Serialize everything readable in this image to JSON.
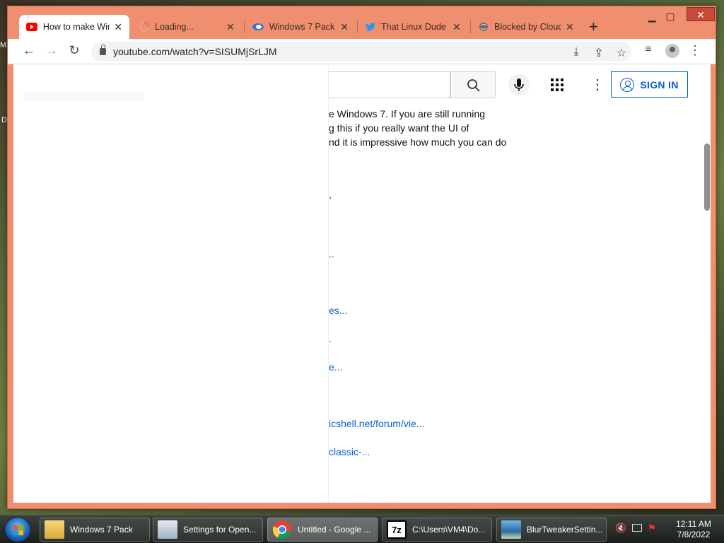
{
  "desktop": {
    "label_top": "M",
    "label_mid": "D"
  },
  "tabs": [
    {
      "title": "How to make Wir",
      "icon": "youtube-icon",
      "active": true
    },
    {
      "title": "Loading...",
      "icon": "loading-spinner-icon",
      "active": false
    },
    {
      "title": "Windows 7 Pack",
      "icon": "windows-pack-icon",
      "active": false
    },
    {
      "title": "That Linux Dude",
      "icon": "twitter-icon",
      "active": false
    },
    {
      "title": "Blocked by Cloud",
      "icon": "globe-icon",
      "active": false
    }
  ],
  "toolbar": {
    "url": "youtube.com/watch?v=SISUMjSrLJM"
  },
  "youtube": {
    "signin_label": "SIGN IN",
    "description_lines": [
      "e Windows 7. If you are still running",
      "g this if you really want the UI of",
      "nd it is impressive how much you can do"
    ],
    "fragments": [
      ",",
      "..",
      "es...",
      ".",
      "e...",
      "icshell.net/forum/vie...",
      "classic-..."
    ]
  },
  "taskbar": {
    "items": [
      {
        "label": "Windows 7 Pack",
        "icon": "folder-icon"
      },
      {
        "label": "Settings for Open...",
        "icon": "settings-window-icon"
      },
      {
        "label": "Untitled - Google ...",
        "icon": "chrome-icon",
        "active": true
      },
      {
        "label": "C:\\Users\\VM4\\Do...",
        "icon": "7zip-icon"
      },
      {
        "label": "BlurTweakerSettin...",
        "icon": "blurtweaker-icon"
      }
    ],
    "time": "12:11 AM",
    "date": "7/8/2022"
  },
  "colors": {
    "frame": "#f08f6f",
    "link": "#065fd4",
    "close": "#c74a3a"
  }
}
